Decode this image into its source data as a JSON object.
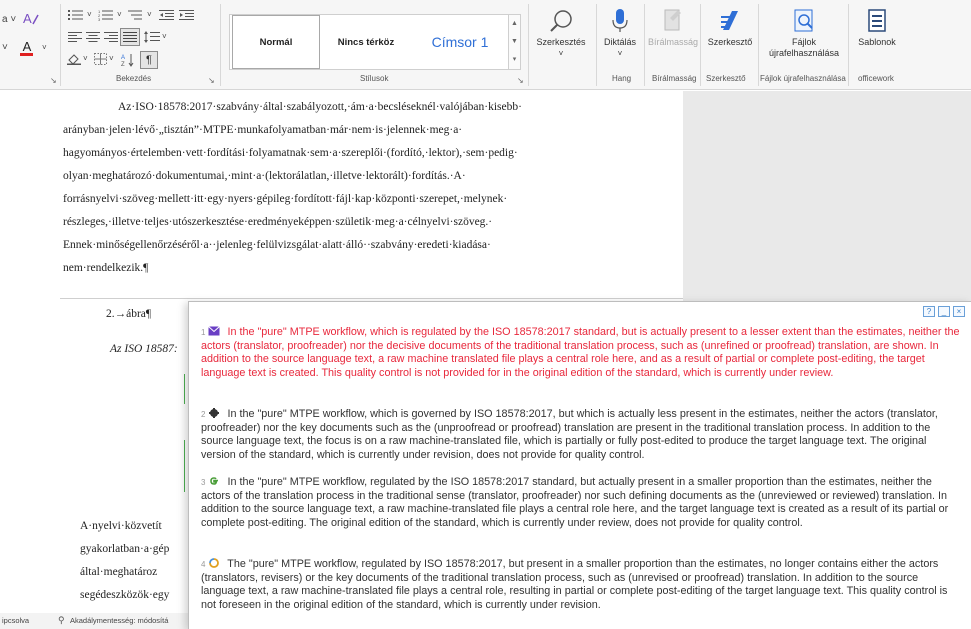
{
  "ribbon": {
    "paragraph_group_label": "Bekezdés",
    "styles_group_label": "Stílusok",
    "hang_group_label": "Hang",
    "biralmassag_group_label": "Bírálmasság",
    "szerkeszto_group_label": "Szerkesztő",
    "reuse_group_label": "Fájlok újrafelhasználása",
    "officework_group_label": "officework",
    "styles": [
      "Normál",
      "Nincs térköz",
      "Címsor 1"
    ],
    "szerkesztes_label": "Szerkesztés",
    "diktalas_label": "Diktálás",
    "biralmassag_label": "Bírálmasság",
    "szerkeszto_label": "Szerkesztő",
    "fajlok_label": "Fájlok újrafelhasználása",
    "sablonok_label": "Sablonok",
    "font_color_letter": "A"
  },
  "document": {
    "paragraph_lines": [
      "Az·ISO·18578:2017·szabvány·által·szabályozott,·ám·a·becsléseknél·valójában·kisebb·",
      "arányban·jelen·lévő·„tisztán”·MTPE·munkafolyamatban·már·nem·is·jelennek·meg·a·",
      "hagyományos·értelemben·vett·fordítási·folyamatnak·sem·a·szereplői·(fordító,·lektor),·sem·pedig·",
      "olyan·meghatározó·dokumentumai,·mint·a·(lektorálatlan,·illetve·lektorált)·fordítás.·A·",
      "forrásnyelvi·szöveg·mellett·itt·egy·nyers·gépileg·fordított·fájl·kap·központi·szerepet,·melynek·",
      "részleges,·illetve·teljes·utószerkesztése·eredményeképpen·születik·meg·a·célnyelvi·szöveg.·",
      "Ennek·minőségellenőrzéséről·a··jelenleg·felülvizsgálat·alatt·álló··szabvány·eredeti·kiadása·",
      "nem·rendelkezik.¶"
    ],
    "figure_label": "2.→ábra¶",
    "figure_caption_fragment": "Az ISO 18587:",
    "lower_fragments": [
      "A·nyelvi·közvetít",
      "gyakorlatban·a·gép",
      "által·meghatároz",
      "segédeszközök·egy"
    ]
  },
  "statusbar": {
    "left_text": "ipcsolva",
    "accessibility_text": "Akadálymentesség: módosítá"
  },
  "popup": {
    "controls": [
      "?",
      "_",
      "×"
    ],
    "suggestions": [
      {
        "num": "1",
        "icon": "envelope-icon",
        "text": "In the \"pure\" MTPE workflow, which is regulated by the ISO 18578:2017 standard, but is actually present to a lesser extent than the estimates, neither the actors (translator, proofreader) nor the decisive documents of the traditional translation process, such as (unrefined or proofread) translation, are shown. In addition to the source language text, a raw machine translated file plays a central role here, and as a result of partial or complete post-editing, the target language text is created. This quality control is not provided for in the original edition of the standard, which is currently under review."
      },
      {
        "num": "2",
        "icon": "gear-icon",
        "text": "In the \"pure\" MTPE workflow, which is governed by ISO 18578:2017, but which is actually less present in the estimates, neither the actors (translator, proofreader) nor the key documents such as the (unproofread or proofread) translation are present in the traditional translation process. In addition to the source language text, the focus is on a raw machine-translated file, which is partially or fully post-edited to produce the target language text. The original version of the standard, which is currently under revision, does not provide for quality control."
      },
      {
        "num": "3",
        "icon": "google-icon",
        "text": "In the \"pure\" MTPE workflow, regulated by the ISO 18578:2017 standard, but actually present in a smaller proportion than the estimates, neither the actors of the translation process in the traditional sense (translator, proofreader) nor such defining documents as the (unreviewed or reviewed) translation. In addition to the source language text, a raw machine-translated file plays a central role here, and the target language text is created as a result of its partial or complete post-editing. The original edition of the standard, which is currently under review, does not provide for quality control."
      },
      {
        "num": "4",
        "icon": "swirl-icon",
        "text": "The \"pure\" MTPE workflow, regulated by ISO 18578:2017, but present in a smaller proportion than the estimates, no longer contains either the actors (translators, revisers) or the key documents of the traditional translation process, such as (unrevised or proofread) translation. In addition to the source language text, a raw machine-translated file plays a central role, resulting in partial or complete post-editing of the target language text. This quality control is not foreseen in the original edition of the standard, which is currently under revision."
      }
    ]
  },
  "colors": {
    "highlight_red": "#e8283c",
    "accent_blue": "#2f6fd6",
    "envelope_purple": "#6a3fc4"
  }
}
